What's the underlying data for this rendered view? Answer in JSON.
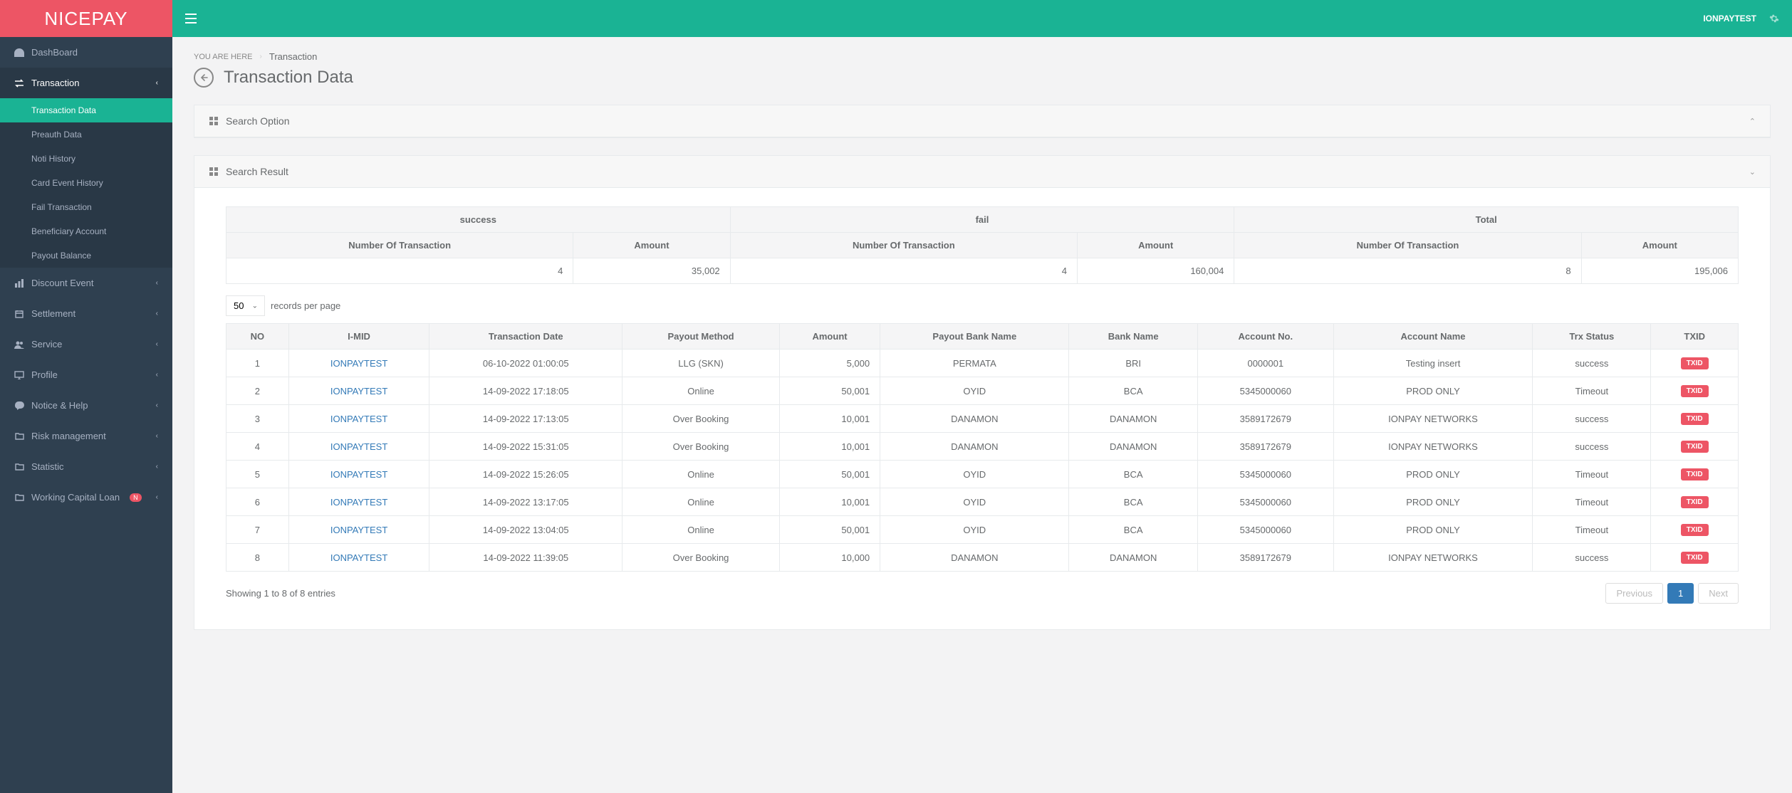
{
  "brand": "NICEPAY",
  "topbar": {
    "user": "IONPAYTEST"
  },
  "breadcrumb": {
    "prefix": "YOU ARE HERE",
    "current": "Transaction"
  },
  "page_title": "Transaction Data",
  "sidebar": {
    "items": [
      {
        "label": "DashBoard",
        "icon": "dashboard"
      },
      {
        "label": "Transaction",
        "icon": "exchange",
        "active": true,
        "children": [
          {
            "label": "Transaction Data",
            "active": true
          },
          {
            "label": "Preauth Data"
          },
          {
            "label": "Noti History"
          },
          {
            "label": "Card Event History"
          },
          {
            "label": "Fail Transaction"
          },
          {
            "label": "Beneficiary Account"
          },
          {
            "label": "Payout Balance"
          }
        ]
      },
      {
        "label": "Discount Event",
        "icon": "chart"
      },
      {
        "label": "Settlement",
        "icon": "calendar"
      },
      {
        "label": "Service",
        "icon": "users"
      },
      {
        "label": "Profile",
        "icon": "desktop"
      },
      {
        "label": "Notice & Help",
        "icon": "comment"
      },
      {
        "label": "Risk management",
        "icon": "folder"
      },
      {
        "label": "Statistic",
        "icon": "folder"
      },
      {
        "label": "Working Capital Loan",
        "icon": "folder",
        "badge": "N"
      }
    ]
  },
  "panels": {
    "search_option": {
      "title": "Search Option"
    },
    "search_result": {
      "title": "Search Result"
    }
  },
  "summary": {
    "group_headers": [
      "success",
      "fail",
      "Total"
    ],
    "sub_headers": [
      "Number Of Transaction",
      "Amount",
      "Number Of Transaction",
      "Amount",
      "Number Of Transaction",
      "Amount"
    ],
    "row": [
      "4",
      "35,002",
      "4",
      "160,004",
      "8",
      "195,006"
    ]
  },
  "records": {
    "per_page_label": "records per page",
    "per_page_value": "50"
  },
  "table": {
    "headers": [
      "NO",
      "I-MID",
      "Transaction Date",
      "Payout Method",
      "Amount",
      "Payout Bank Name",
      "Bank Name",
      "Account No.",
      "Account Name",
      "Trx  Status",
      "TXID"
    ],
    "txid_label": "TXID",
    "rows": [
      {
        "no": "1",
        "imid": "IONPAYTEST",
        "date": "06-10-2022 01:00:05",
        "method": "LLG (SKN)",
        "amount": "5,000",
        "payout_bank": "PERMATA",
        "bank": "BRI",
        "acct_no": "0000001",
        "acct_name": "Testing insert",
        "status": "success"
      },
      {
        "no": "2",
        "imid": "IONPAYTEST",
        "date": "14-09-2022 17:18:05",
        "method": "Online",
        "amount": "50,001",
        "payout_bank": "OYID",
        "bank": "BCA",
        "acct_no": "5345000060",
        "acct_name": "PROD ONLY",
        "status": "Timeout"
      },
      {
        "no": "3",
        "imid": "IONPAYTEST",
        "date": "14-09-2022 17:13:05",
        "method": "Over Booking",
        "amount": "10,001",
        "payout_bank": "DANAMON",
        "bank": "DANAMON",
        "acct_no": "3589172679",
        "acct_name": "IONPAY NETWORKS",
        "status": "success"
      },
      {
        "no": "4",
        "imid": "IONPAYTEST",
        "date": "14-09-2022 15:31:05",
        "method": "Over Booking",
        "amount": "10,001",
        "payout_bank": "DANAMON",
        "bank": "DANAMON",
        "acct_no": "3589172679",
        "acct_name": "IONPAY NETWORKS",
        "status": "success"
      },
      {
        "no": "5",
        "imid": "IONPAYTEST",
        "date": "14-09-2022 15:26:05",
        "method": "Online",
        "amount": "50,001",
        "payout_bank": "OYID",
        "bank": "BCA",
        "acct_no": "5345000060",
        "acct_name": "PROD ONLY",
        "status": "Timeout"
      },
      {
        "no": "6",
        "imid": "IONPAYTEST",
        "date": "14-09-2022 13:17:05",
        "method": "Online",
        "amount": "10,001",
        "payout_bank": "OYID",
        "bank": "BCA",
        "acct_no": "5345000060",
        "acct_name": "PROD ONLY",
        "status": "Timeout"
      },
      {
        "no": "7",
        "imid": "IONPAYTEST",
        "date": "14-09-2022 13:04:05",
        "method": "Online",
        "amount": "50,001",
        "payout_bank": "OYID",
        "bank": "BCA",
        "acct_no": "5345000060",
        "acct_name": "PROD ONLY",
        "status": "Timeout"
      },
      {
        "no": "8",
        "imid": "IONPAYTEST",
        "date": "14-09-2022 11:39:05",
        "method": "Over Booking",
        "amount": "10,000",
        "payout_bank": "DANAMON",
        "bank": "DANAMON",
        "acct_no": "3589172679",
        "acct_name": "IONPAY NETWORKS",
        "status": "success"
      }
    ]
  },
  "footer": {
    "showing": "Showing 1 to 8 of 8 entries",
    "pager": {
      "prev": "Previous",
      "page": "1",
      "next": "Next"
    }
  }
}
